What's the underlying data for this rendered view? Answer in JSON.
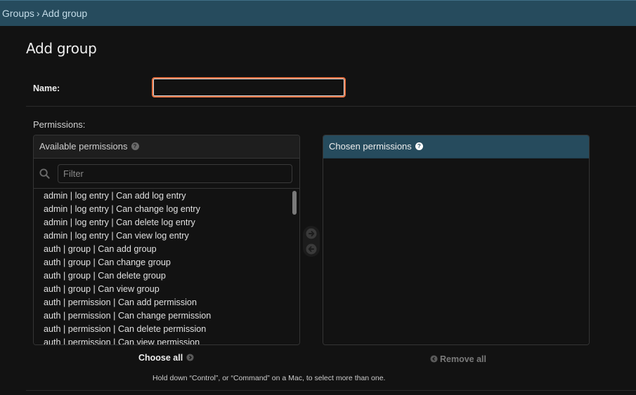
{
  "breadcrumbs": {
    "parent": "Groups",
    "separator": "›",
    "current": "Add group"
  },
  "page_title": "Add group",
  "form": {
    "name_label": "Name:",
    "name_value": "",
    "permissions_label": "Permissions:"
  },
  "available": {
    "title": "Available permissions",
    "help_icon": "question-circle-icon",
    "filter_placeholder": "Filter",
    "filter_value": "",
    "options": [
      "admin | log entry | Can add log entry",
      "admin | log entry | Can change log entry",
      "admin | log entry | Can delete log entry",
      "admin | log entry | Can view log entry",
      "auth | group | Can add group",
      "auth | group | Can change group",
      "auth | group | Can delete group",
      "auth | group | Can view group",
      "auth | permission | Can add permission",
      "auth | permission | Can change permission",
      "auth | permission | Can delete permission",
      "auth | permission | Can view permission"
    ],
    "choose_all_label": "Choose all"
  },
  "chosen": {
    "title": "Chosen permissions",
    "help_icon": "question-circle-icon",
    "options": [],
    "remove_all_label": "Remove all"
  },
  "help_text": "Hold down “Control”, or “Command” on a Mac, to select more than one.",
  "colors": {
    "header_bg": "#264b5d",
    "focus_border": "#e46f3f",
    "page_bg": "#121212"
  }
}
